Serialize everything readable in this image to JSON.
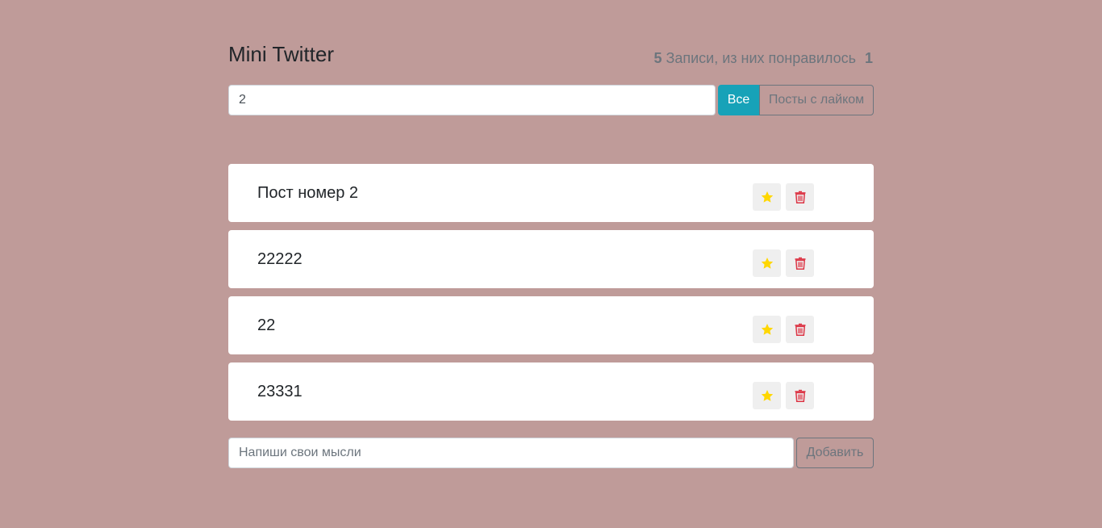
{
  "header": {
    "title": "Mini Twitter",
    "total_count": "5",
    "total_label": "Записи, из них понравилось",
    "liked_count": "1"
  },
  "search": {
    "value": "2"
  },
  "filter": {
    "all_label": "Все",
    "liked_label": "Посты с лайком",
    "active": "Все"
  },
  "posts": [
    {
      "label": "Пост номер 2"
    },
    {
      "label": "22222"
    },
    {
      "label": "22"
    },
    {
      "label": "23331"
    }
  ],
  "add_form": {
    "placeholder": "Напиши свои мысли",
    "button_label": "Добавить"
  },
  "colors": {
    "background": "#bf9b99",
    "accent": "#17a2b8",
    "star": "#ffd700",
    "trash": "#dc3545"
  },
  "icons": {
    "star": "star-icon",
    "trash": "trash-icon"
  }
}
